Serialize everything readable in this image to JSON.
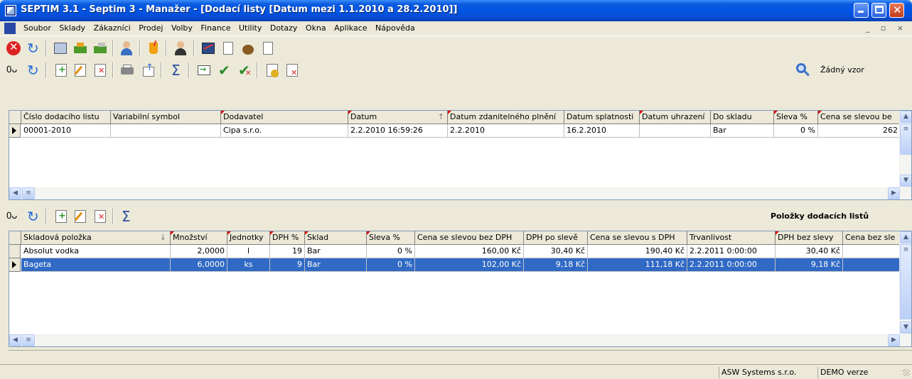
{
  "window": {
    "title": "SEPTIM 3.1 - Septim 3 - Manažer - [Dodací listy [Datum mezi 1.1.2010 a 28.2.2010]]"
  },
  "menu": {
    "items": [
      "Soubor",
      "Sklady",
      "Zákazníci",
      "Prodej",
      "Volby",
      "Finance",
      "Utility",
      "Dotazy",
      "Okna",
      "Aplikace",
      "Nápověda"
    ],
    "mdi_controls": "_ ▫ ×"
  },
  "filter": {
    "label": "Žádný vzor"
  },
  "upper_grid": {
    "columns": [
      "Číslo dodacího listu",
      "Variabilní symbol",
      "Dodavatel",
      "Datum",
      "Datum zdanitelného plnění",
      "Datum splatnosti",
      "Datum uhrazení",
      "Do skladu",
      "Sleva %",
      "Cena se slevou be"
    ],
    "rows": [
      [
        "00001-2010",
        "",
        "Cipa s.r.o.",
        "2.2.2010 16:59:26",
        "2.2.2010",
        "16.2.2010",
        "",
        "Bar",
        "0 %",
        "262"
      ]
    ]
  },
  "lower_panel": {
    "title": "Položky dodacích listů"
  },
  "lower_grid": {
    "columns": [
      "Skladová položka",
      "Množství",
      "Jednotky",
      "DPH %",
      "Sklad",
      "Sleva %",
      "Cena se slevou bez DPH",
      "DPH po slevě",
      "Cena se slevou s DPH",
      "Trvanlivost",
      "DPH bez slevy",
      "Cena bez sle"
    ],
    "rows": [
      [
        "Absolut vodka",
        "2,0000",
        "l",
        "19",
        "Bar",
        "0 %",
        "160,00 Kč",
        "30,40 Kč",
        "190,40 Kč",
        "2.2.2011 0:00:00",
        "30,40 Kč",
        ""
      ],
      [
        "Bageta",
        "6,0000",
        "ks",
        "9",
        "Bar",
        "0 %",
        "102,00 Kč",
        "9,18 Kč",
        "111,18 Kč",
        "2.2.2011 0:00:00",
        "9,18 Kč",
        ""
      ]
    ]
  },
  "statusbar": {
    "company": "ASW Systems s.r.o.",
    "edition": "DEMO verze"
  },
  "colors": {
    "titlebar": "#0054E3",
    "selection": "#316AC5",
    "chrome": "#ECE9D8"
  }
}
